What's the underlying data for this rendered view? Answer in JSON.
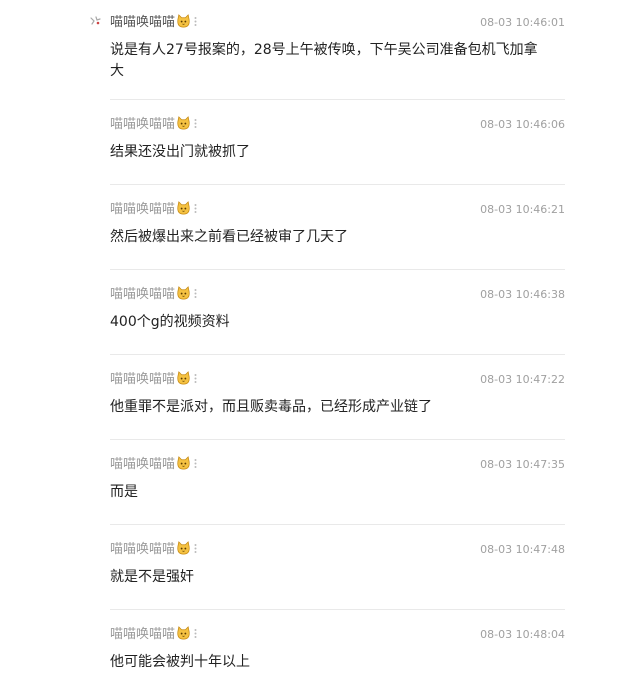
{
  "messages": [
    {
      "user": "喵喵唤喵喵",
      "time": "08-03 10:46:01",
      "text": "说是有人27号报案的，28号上午被传唤，下午吴公司准备包机飞加拿大"
    },
    {
      "user": "喵喵唤喵喵",
      "time": "08-03 10:46:06",
      "text": "结果还没出门就被抓了"
    },
    {
      "user": "喵喵唤喵喵",
      "time": "08-03 10:46:21",
      "text": "然后被爆出来之前看已经被审了几天了"
    },
    {
      "user": "喵喵唤喵喵",
      "time": "08-03 10:46:38",
      "text": "400个g的视频资料"
    },
    {
      "user": "喵喵唤喵喵",
      "time": "08-03 10:47:22",
      "text": "他重罪不是派对，而且贩卖毒品，已经形成产业链了"
    },
    {
      "user": "喵喵唤喵喵",
      "time": "08-03 10:47:35",
      "text": "而是"
    },
    {
      "user": "喵喵唤喵喵",
      "time": "08-03 10:47:48",
      "text": "就是不是强奸"
    },
    {
      "user": "喵喵唤喵喵",
      "time": "08-03 10:48:04",
      "text": "他可能会被判十年以上"
    }
  ],
  "icons": {
    "avatar": "avatar-icon",
    "badge": "cat-emoji-icon",
    "more": "more-dots-icon"
  },
  "colors": {
    "username": "#9a9a9a",
    "text": "#222222",
    "timestamp": "#a0a0a0",
    "divider": "#e9e9e9",
    "badge": "#f5c242"
  }
}
